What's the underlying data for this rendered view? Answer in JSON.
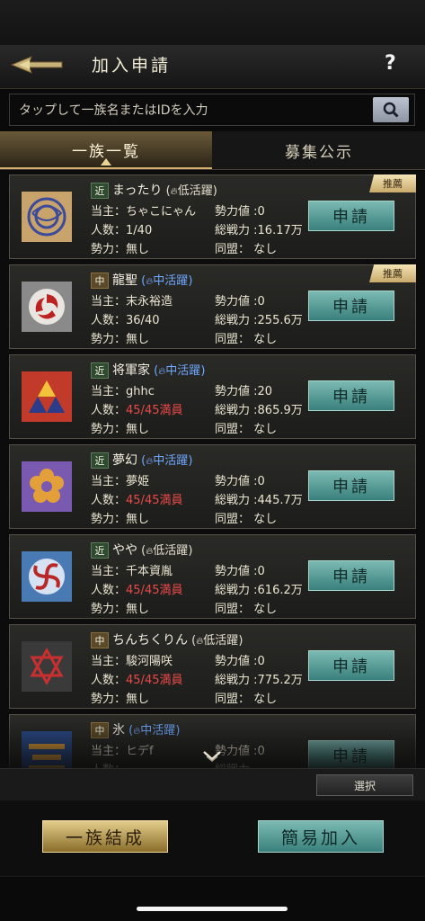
{
  "header": {
    "title": "加入申請",
    "help": "?",
    "back_icon": "spear-back-icon"
  },
  "search": {
    "placeholder": "タップして一族名またはIDを入力",
    "button_icon": "search-icon"
  },
  "tabs": [
    {
      "label": "一族一覧",
      "active": true
    },
    {
      "label": "募集公示",
      "active": false
    }
  ],
  "labels": {
    "leader": "当主：",
    "members": "人数：",
    "faction": "勢力：",
    "power": "勢力値",
    "total": "総戦力",
    "alliance": "同盟：",
    "apply": "申請",
    "recommended": "推薦"
  },
  "clans": [
    {
      "region": "近",
      "name": "まったり",
      "activity": "低活躍",
      "leader": "ちゃこにゃん",
      "members": "1/40",
      "full": false,
      "faction": "無し",
      "power": ":0",
      "total": ":16.17万",
      "alliance": "なし",
      "recommended": true,
      "emblem": "circle-knot"
    },
    {
      "region": "中",
      "name": "龍聖",
      "activity": "中活躍",
      "leader": "末永裕造",
      "members": "36/40",
      "full": false,
      "faction": "無し",
      "power": ":0",
      "total": ":255.6万",
      "alliance": "なし",
      "recommended": true,
      "emblem": "tomoe"
    },
    {
      "region": "近",
      "name": "将軍家",
      "activity": "中活躍",
      "leader": "ghhc",
      "members": "45/45満員",
      "full": true,
      "faction": "無し",
      "power": ":20",
      "total": ":865.9万",
      "alliance": "なし",
      "recommended": false,
      "emblem": "triforce"
    },
    {
      "region": "近",
      "name": "夢幻",
      "activity": "中活躍",
      "leader": "夢姫",
      "members": "45/45満員",
      "full": true,
      "faction": "無し",
      "power": ":0",
      "total": ":445.7万",
      "alliance": "なし",
      "recommended": false,
      "emblem": "plum-flower"
    },
    {
      "region": "近",
      "name": "やや",
      "activity": "低活躍",
      "leader": "千本資胤",
      "members": "45/45満員",
      "full": true,
      "faction": "無し",
      "power": ":0",
      "total": ":616.2万",
      "alliance": "なし",
      "recommended": false,
      "emblem": "whirl"
    },
    {
      "region": "中",
      "name": "ちんちくりん",
      "activity": "低活躍",
      "leader": "駿河陽咲",
      "members": "45/45満員",
      "full": true,
      "faction": "無し",
      "power": ":0",
      "total": ":775.2万",
      "alliance": "なし",
      "recommended": false,
      "emblem": "hexagram"
    },
    {
      "region": "中",
      "name": "氷",
      "activity": "中活躍",
      "leader": "ヒデf",
      "members": "",
      "full": false,
      "faction": "",
      "power": ":0",
      "total": "",
      "alliance": "",
      "recommended": false,
      "emblem": "bars"
    }
  ],
  "footer": {
    "select": "選択",
    "form_clan": "一族結成",
    "quick_join": "簡易加入"
  },
  "colors": {
    "accent_teal": "#4a9690",
    "accent_gold": "#c8a656",
    "full_red": "#e84a4a",
    "activity_blue": "#6fa8ff"
  }
}
